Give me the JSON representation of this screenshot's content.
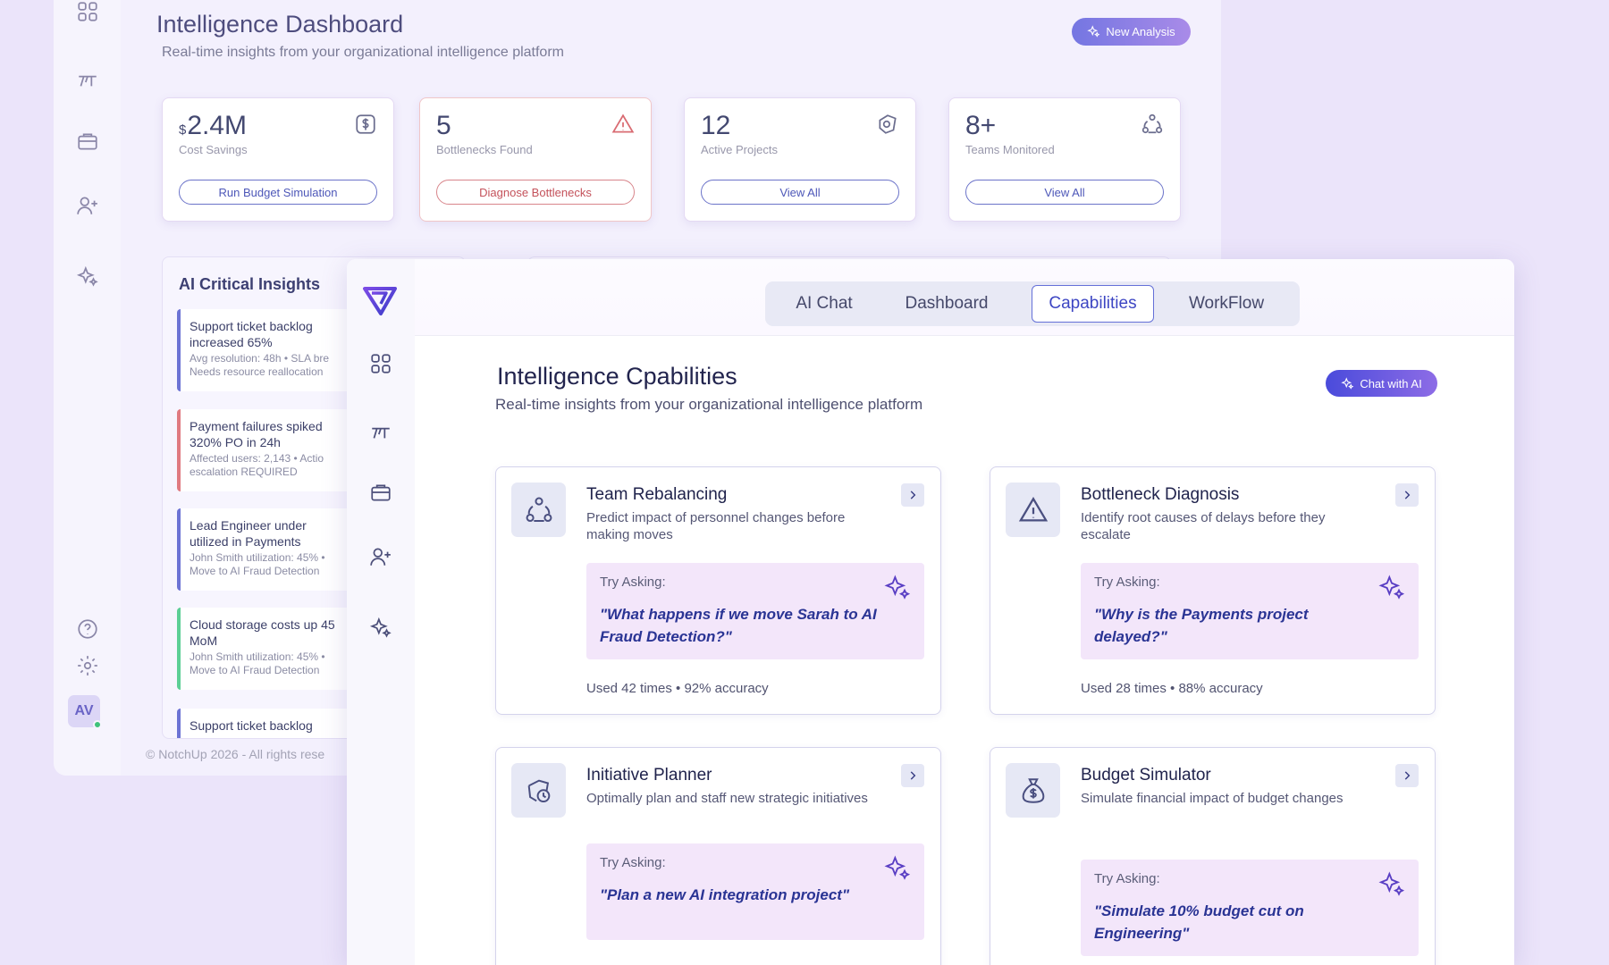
{
  "back": {
    "title": "Intelligence Dashboard",
    "subtitle": "Real-time insights from your organizational intelligence platform",
    "new_analysis": "New Analysis",
    "stats": [
      {
        "currency": "$",
        "value": "2.4M",
        "label": "Cost Savings",
        "button": "Run Budget Simulation",
        "icon": "dollar-icon"
      },
      {
        "value": "5",
        "label": "Bottlenecks Found",
        "button": "Diagnose Bottlenecks",
        "icon": "warning-icon"
      },
      {
        "value": "12",
        "label": "Active Projects",
        "button": "View All",
        "icon": "projects-icon"
      },
      {
        "value": "8+",
        "label": "Teams Monitored",
        "button": "View All",
        "icon": "teams-icon"
      }
    ],
    "insights_title": "AI Critical Insights",
    "insights": [
      {
        "title": "Support ticket backlog\nincreased 65%",
        "detail": "Avg resolution: 48h • SLA bre\nNeeds resource reallocation",
        "color": "#6c73d4"
      },
      {
        "title": "Payment failures spiked\n320% PO in 24h",
        "detail": "Affected users: 2,143 • Actio\nescalation REQUIRED",
        "color": "#e07a80"
      },
      {
        "title": "Lead Engineer under\nutilized in Payments",
        "detail": "John Smith utilization: 45% •\nMove to AI Fraud Detection",
        "color": "#6c73d4"
      },
      {
        "title": "Cloud storage costs up 45\nMoM",
        "detail": "John Smith utilization: 45% •\nMove to AI Fraud Detection",
        "color": "#5ccf95"
      },
      {
        "title": "Support ticket backlog",
        "detail": "",
        "color": "#6c73d4"
      }
    ],
    "avatar": "AV",
    "footer": "© NotchUp 2026 - All rights rese"
  },
  "front": {
    "tabs": [
      "AI Chat",
      "Dashboard",
      "Capabilities",
      "WorkFlow"
    ],
    "active_tab": "Capabilities",
    "title": "Intelligence Cpabilities",
    "subtitle": "Real-time insights from your organizational intelligence platform",
    "chat_button": "Chat with AI",
    "cards": [
      {
        "title": "Team Rebalancing",
        "desc": "Predict impact of personnel changes before making moves",
        "try_label": "Try Asking:",
        "question": "\"What happens if we move Sarah to AI Fraud Detection?\"",
        "stats": "Used 42 times  •  92% accuracy",
        "icon": "team-cycle-icon"
      },
      {
        "title": "Bottleneck Diagnosis",
        "desc": "Identify root causes of delays before they escalate",
        "try_label": "Try Asking:",
        "question": "\"Why is the Payments project delayed?\"",
        "stats": "Used 28 times  •  88% accuracy",
        "icon": "warning-icon"
      },
      {
        "title": "Initiative Planner",
        "desc": "Optimally plan and staff new strategic initiatives",
        "try_label": "Try Asking:",
        "question": "\"Plan a new AI integration project\"",
        "stats": "",
        "icon": "planner-icon"
      },
      {
        "title": "Budget Simulator",
        "desc": "Simulate financial impact of budget changes",
        "try_label": "Try Asking:",
        "question": "\"Simulate 10% budget cut on Engineering\"",
        "stats": "",
        "icon": "money-bag-icon"
      }
    ]
  }
}
